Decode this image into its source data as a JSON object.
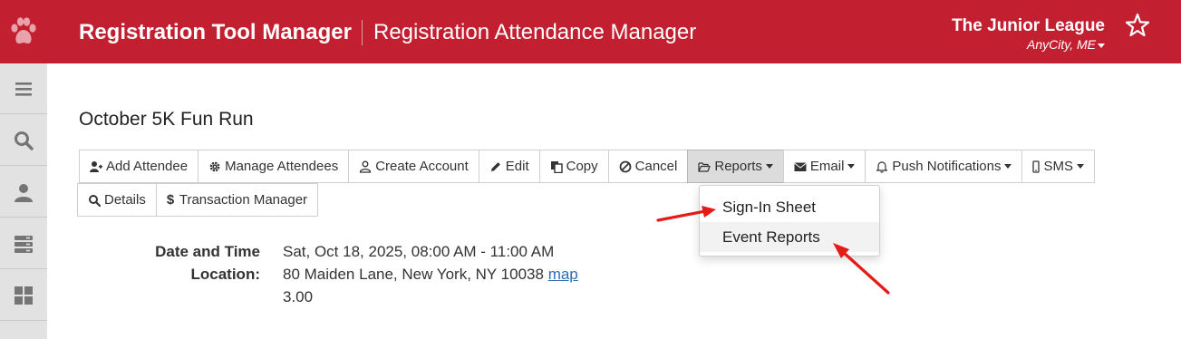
{
  "header": {
    "app_title": "Registration Tool Manager",
    "sub_title": "Registration Attendance Manager",
    "org_name": "The Junior League",
    "org_city": "AnyCity, ME",
    "logo_icon": "paw-icon",
    "favorite_icon": "star-icon"
  },
  "colors": {
    "brand": "#c21f30",
    "link": "#2f6db5",
    "annotation_arrow": "#e41b17"
  },
  "sidebar": {
    "items": [
      {
        "icon": "menu-icon"
      },
      {
        "icon": "search-icon"
      },
      {
        "icon": "user-icon"
      },
      {
        "icon": "server-icon"
      },
      {
        "icon": "grid-icon"
      }
    ]
  },
  "event": {
    "title": "October 5K Fun Run"
  },
  "toolbar": {
    "add_attendee": "Add Attendee",
    "manage_attendees": "Manage Attendees",
    "create_account": "Create Account",
    "edit": "Edit",
    "copy": "Copy",
    "cancel": "Cancel",
    "reports": "Reports",
    "email": "Email",
    "push_notifications": "Push Notifications",
    "sms": "SMS",
    "details": "Details",
    "transaction_manager": "Transaction Manager"
  },
  "reports_menu": {
    "items": [
      {
        "label": "Sign-In Sheet"
      },
      {
        "label": "Event Reports"
      }
    ]
  },
  "details": {
    "date_label": "Date and Time",
    "date_value": "Sat, Oct 18, 2025, 08:00 AM - 11:00 AM",
    "location_label": "Location:",
    "location_value": "80 Maiden Lane, New York, NY 10038",
    "map_link": "map",
    "extra_value": "3.00"
  }
}
